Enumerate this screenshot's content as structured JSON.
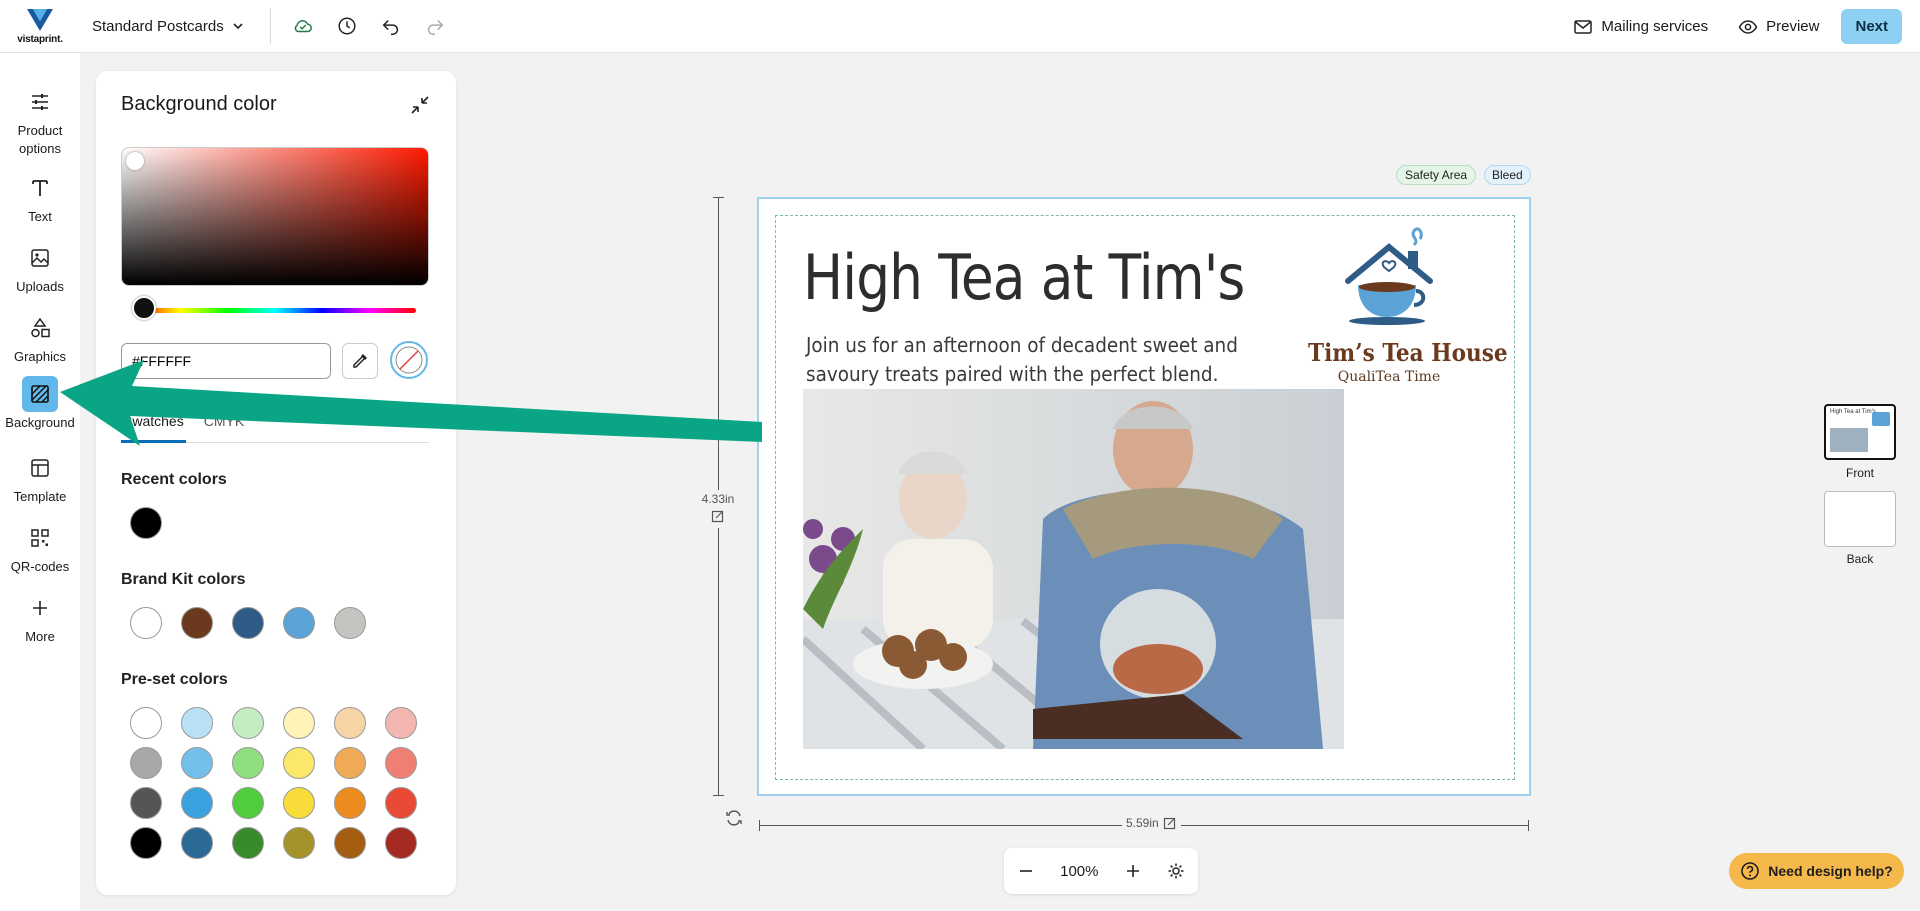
{
  "topbar": {
    "logo_text": "vistaprint.",
    "product_label": "Standard Postcards",
    "mailing_label": "Mailing services",
    "preview_label": "Preview",
    "next_label": "Next"
  },
  "rail": {
    "items": [
      {
        "label": "Product options",
        "icon": "sliders-icon"
      },
      {
        "label": "Text",
        "icon": "text-icon"
      },
      {
        "label": "Uploads",
        "icon": "image-icon"
      },
      {
        "label": "Graphics",
        "icon": "shapes-icon"
      },
      {
        "label": "Background",
        "icon": "background-icon",
        "active": true
      },
      {
        "label": "Template",
        "icon": "template-icon"
      },
      {
        "label": "QR-codes",
        "icon": "qr-icon"
      },
      {
        "label": "More",
        "icon": "plus-icon"
      }
    ]
  },
  "panel": {
    "title": "Background color",
    "hex_value": "#FFFFFF",
    "tabs": [
      "Swatches",
      "CMYK"
    ],
    "recent_title": "Recent colors",
    "recent_colors": [
      "#000000"
    ],
    "brand_title": "Brand Kit colors",
    "brand_colors": [
      "#ffffff",
      "#6b3a1e",
      "#2f5c86",
      "#5ba3d6",
      "#c6c4c0"
    ],
    "preset_title": "Pre-set colors",
    "preset_colors": [
      [
        "#ffffff",
        "#b9e0f5",
        "#c4edc4",
        "#fff3b8",
        "#f7d4a6",
        "#f4b6b1"
      ],
      [
        "#a8a8a8",
        "#72c0ea",
        "#8fde7f",
        "#fbe76a",
        "#f0aa56",
        "#ef7f72"
      ],
      [
        "#555555",
        "#3aa2df",
        "#52cc3f",
        "#f8dc3a",
        "#ec8c1f",
        "#e84a36"
      ],
      [
        "#000000",
        "#2c6a96",
        "#388a2a",
        "#a59329",
        "#a55d12",
        "#a42a22"
      ]
    ]
  },
  "canvas": {
    "headline": "High Tea at Tim's",
    "subtext": "Join us for an afternoon of decadent sweet and savoury treats paired with the perfect blend.",
    "brand_name": "Tim’s Tea House",
    "brand_tagline": "QualiTea Time",
    "safety_label": "Safety Area",
    "bleed_label": "Bleed",
    "height_label": "4.33in",
    "width_label": "5.59in"
  },
  "zoom": {
    "level": "100%"
  },
  "pages": [
    {
      "label": "Front",
      "thumb_text": "High Tea at Tim's",
      "active": true
    },
    {
      "label": "Back",
      "active": false
    }
  ],
  "help_label": "Need design help?",
  "colors": {
    "accent": "#62b8ea",
    "next": "#8dd0f2",
    "arrow": "#0aa585",
    "help": "#f5b84a"
  }
}
